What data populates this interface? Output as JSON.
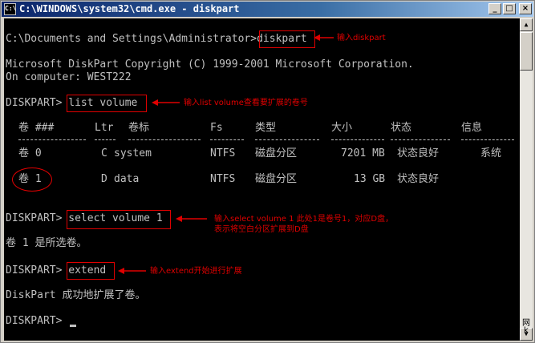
{
  "window": {
    "title": "C:\\WINDOWS\\system32\\cmd.exe - diskpart",
    "icon_label": "C:\\",
    "minimize_glyph": "_",
    "maximize_glyph": "□",
    "close_glyph": "×"
  },
  "console": {
    "line1": "C:\\Documents and Settings\\Administrator>diskpart",
    "line2": "Microsoft DiskPart Copyright (C) 1999-2001 Microsoft Corporation.",
    "line3": "On computer: WEST222",
    "line4": "DISKPART> list volume",
    "table": {
      "headers": [
        "卷 ###",
        "Ltr",
        "卷标",
        "Fs",
        "类型",
        "大小",
        "状态",
        "信息"
      ],
      "rows": [
        [
          "卷 0",
          "C",
          "system",
          "NTFS",
          "磁盘分区",
          "7201 MB",
          "状态良好",
          "系统"
        ],
        [
          "卷 1",
          "D",
          "data",
          "NTFS",
          "磁盘分区",
          "13 GB",
          "状态良好",
          ""
        ]
      ]
    },
    "line5": "DISKPART> select volume 1",
    "line6": "卷 1 是所选卷。",
    "line7": "DISKPART> extend",
    "line8": "DiskPart 成功地扩展了卷。",
    "line9": "DISKPART> "
  },
  "annotations": {
    "a1": "输入diskpart",
    "a2": "输入list volume查看要扩展的卷号",
    "a3_line1": "输入select volume 1  此处1是卷号1，对应D盘，",
    "a3_line2": "表示将空白分区扩展到D盘",
    "a4": "输入extend开始进行扩展"
  },
  "scrollbar": {
    "up_glyph": "▲",
    "down_glyph": "▼"
  },
  "watermark": {
    "w1": "网",
    "w2": "k"
  },
  "colors": {
    "annotation": "#e00000",
    "console_bg": "#000000",
    "console_fg": "#c0c0c0",
    "title_start": "#0a246a",
    "title_end": "#a6caf0"
  }
}
